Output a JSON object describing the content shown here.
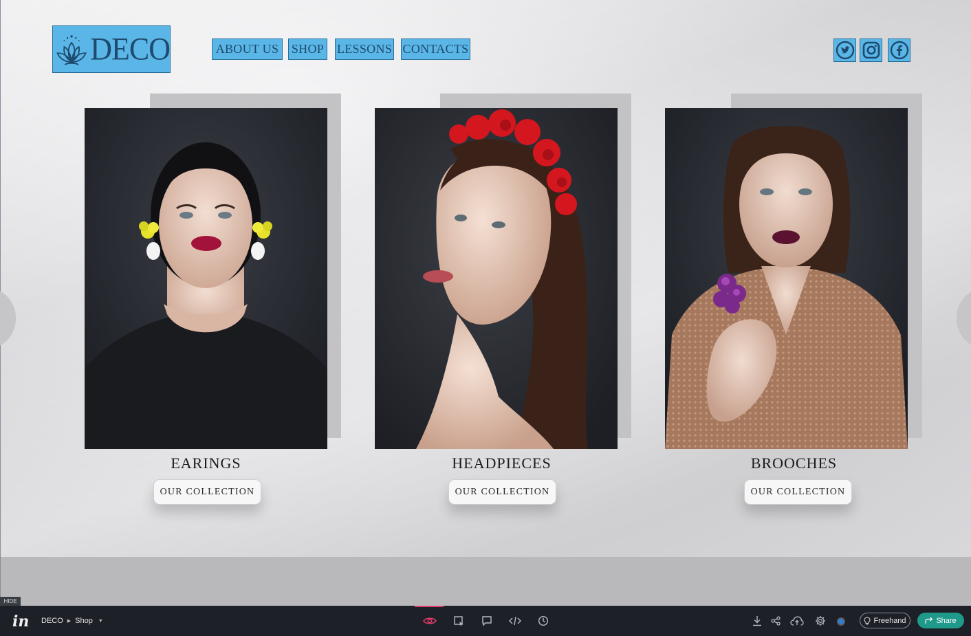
{
  "brand": {
    "logo_text": "DECO"
  },
  "nav": {
    "items": [
      {
        "label": "ABOUT US"
      },
      {
        "label": "SHOP"
      },
      {
        "label": "LESSONS"
      },
      {
        "label": "CONTACTS"
      }
    ]
  },
  "social": [
    {
      "icon": "twitter-icon"
    },
    {
      "icon": "instagram-icon"
    },
    {
      "icon": "facebook-icon"
    }
  ],
  "cards": [
    {
      "title": "EARINGS",
      "button_label": "OUR COLLECTION",
      "photo": "model-with-yellow-flower-earrings"
    },
    {
      "title": "HEADPIECES",
      "button_label": "OUR COLLECTION",
      "photo": "model-with-red-flower-headpiece"
    },
    {
      "title": "BROOCHES",
      "button_label": "OUR COLLECTION",
      "photo": "model-with-purple-flower-brooch"
    }
  ],
  "hide_tag": "HIDE",
  "toolbar": {
    "project": "DECO",
    "screen": "Shop",
    "freehand_label": "Freehand",
    "share_label": "Share",
    "center_icons": [
      "preview-eye-icon",
      "inspect-icon",
      "comment-icon",
      "code-icon",
      "history-icon"
    ],
    "right_icons": [
      "download-icon",
      "share-nodes-icon",
      "cloud-upload-icon",
      "settings-icon"
    ]
  },
  "colors": {
    "hotspot": "#5ab6e6",
    "brand_text": "#1d4a6e",
    "toolbar_bg": "#1e2028",
    "share_green": "#1f9a8a",
    "active_pink": "#e33b6a"
  }
}
